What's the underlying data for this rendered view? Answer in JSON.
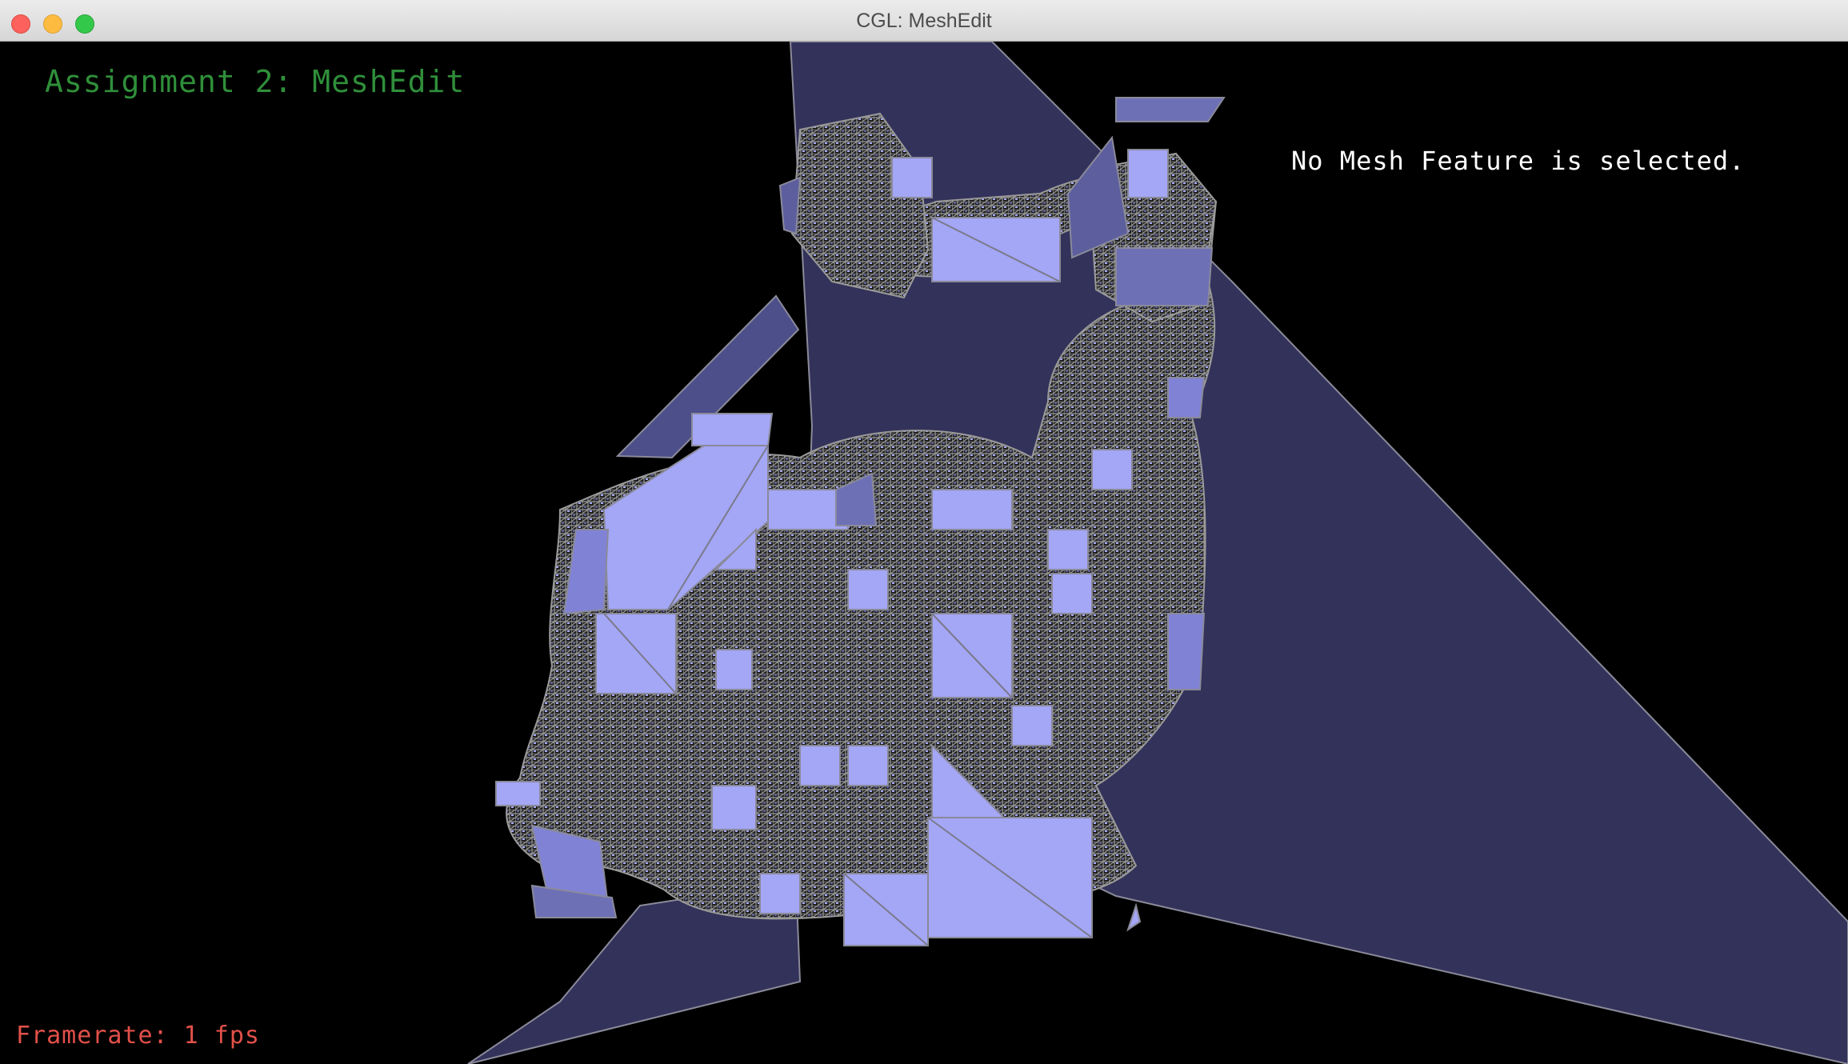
{
  "window": {
    "title": "CGL: MeshEdit"
  },
  "hud": {
    "assignment_title": "Assignment 2: MeshEdit",
    "selection_status": "No Mesh Feature is selected.",
    "framerate": "Framerate: 1 fps"
  },
  "colors": {
    "background": "#000000",
    "mesh_face": "#a4a6f6",
    "mesh_face_shadow": "#5c5e9e",
    "large_plane": "#33325a",
    "wire": "#8a8a8a",
    "title_green": "#2f8f3a",
    "fps_red": "#e2504a"
  }
}
